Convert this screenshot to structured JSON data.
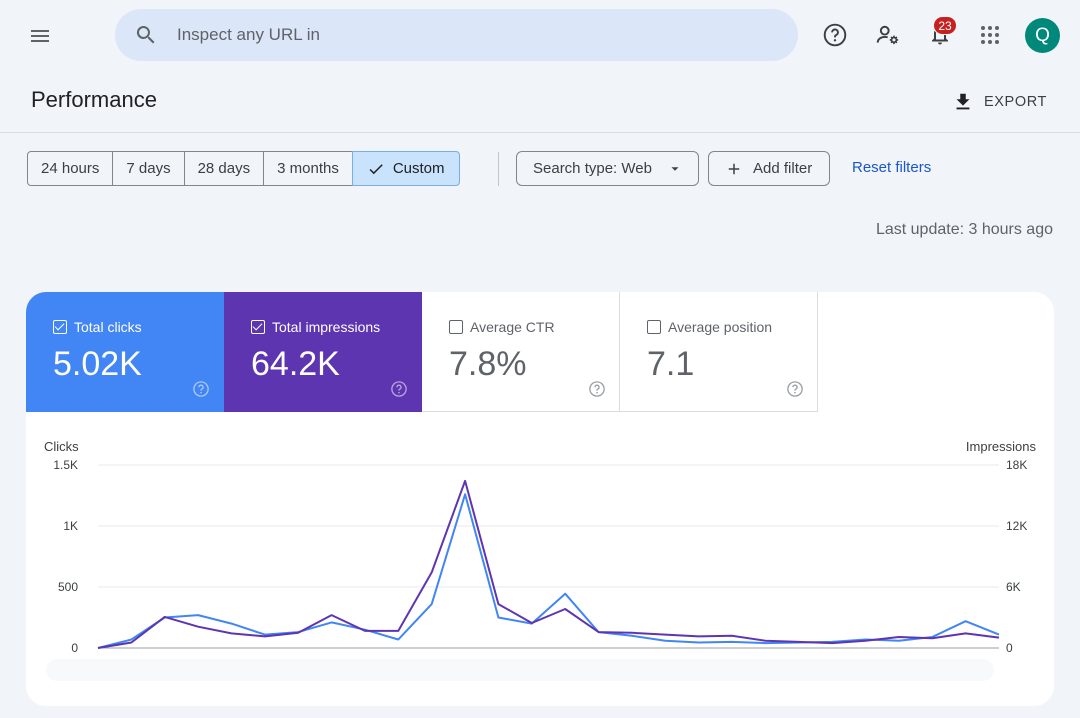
{
  "header": {
    "search_placeholder": "Inspect any URL in",
    "notification_count": "23",
    "avatar_initial": "Q"
  },
  "page": {
    "title": "Performance",
    "export_label": "EXPORT",
    "last_update": "Last update: 3 hours ago"
  },
  "filters": {
    "ranges": [
      {
        "label": "24 hours",
        "active": false
      },
      {
        "label": "7 days",
        "active": false
      },
      {
        "label": "28 days",
        "active": false
      },
      {
        "label": "3 months",
        "active": false
      },
      {
        "label": "Custom",
        "active": true
      }
    ],
    "search_type_label": "Search type: Web",
    "add_filter_label": "Add filter",
    "reset_label": "Reset filters"
  },
  "metrics": [
    {
      "label": "Total clicks",
      "value": "5.02K",
      "checked": true,
      "color": "#4285f4"
    },
    {
      "label": "Total impressions",
      "value": "64.2K",
      "checked": true,
      "color": "#5e35b1"
    },
    {
      "label": "Average CTR",
      "value": "7.8%",
      "checked": false,
      "color": "#ffffff"
    },
    {
      "label": "Average position",
      "value": "7.1",
      "checked": false,
      "color": "#ffffff"
    }
  ],
  "chart_data": {
    "type": "line",
    "left_axis": {
      "title": "Clicks",
      "ticks": [
        "1.5K",
        "1K",
        "500",
        "0"
      ],
      "range": [
        0,
        1500
      ]
    },
    "right_axis": {
      "title": "Impressions",
      "ticks": [
        "18K",
        "12K",
        "6K",
        "0"
      ],
      "range": [
        0,
        18000
      ]
    },
    "series": [
      {
        "name": "Total clicks",
        "axis": "left",
        "color": "#4285f4",
        "values": [
          0,
          70,
          250,
          270,
          200,
          110,
          130,
          210,
          150,
          70,
          360,
          1260,
          250,
          200,
          445,
          130,
          100,
          60,
          45,
          50,
          40,
          45,
          50,
          70,
          60,
          90,
          220,
          110
        ]
      },
      {
        "name": "Total impressions",
        "axis": "right",
        "color": "#5e35b1",
        "values": [
          0,
          540,
          3060,
          2100,
          1440,
          1140,
          1500,
          3240,
          1680,
          1680,
          7440,
          16440,
          4320,
          2460,
          3840,
          1560,
          1500,
          1320,
          1140,
          1200,
          720,
          600,
          480,
          720,
          1080,
          960,
          1440,
          1020
        ]
      }
    ],
    "grid": true,
    "legend": "none"
  }
}
